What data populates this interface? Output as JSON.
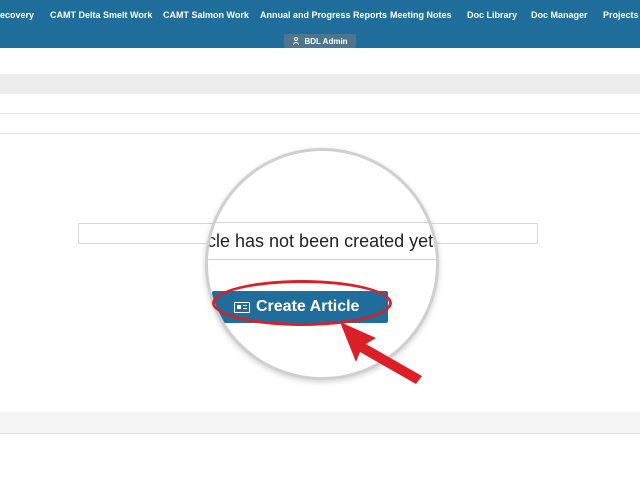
{
  "nav": {
    "items": [
      "ecovery",
      "CAMT Delta Smelt Work",
      "CAMT Salmon Work",
      "Annual and Progress Reports",
      "Meeting Notes",
      "Doc Library",
      "Doc Manager",
      "Projects"
    ],
    "admin_label": "BDL Admin"
  },
  "content": {
    "notice_text": "cle has not been created yet.",
    "create_button_label": "Create Article"
  },
  "colors": {
    "nav_bg": "#1f6d9b",
    "button_bg": "#1f6d9b",
    "highlight": "#dc1f26"
  }
}
